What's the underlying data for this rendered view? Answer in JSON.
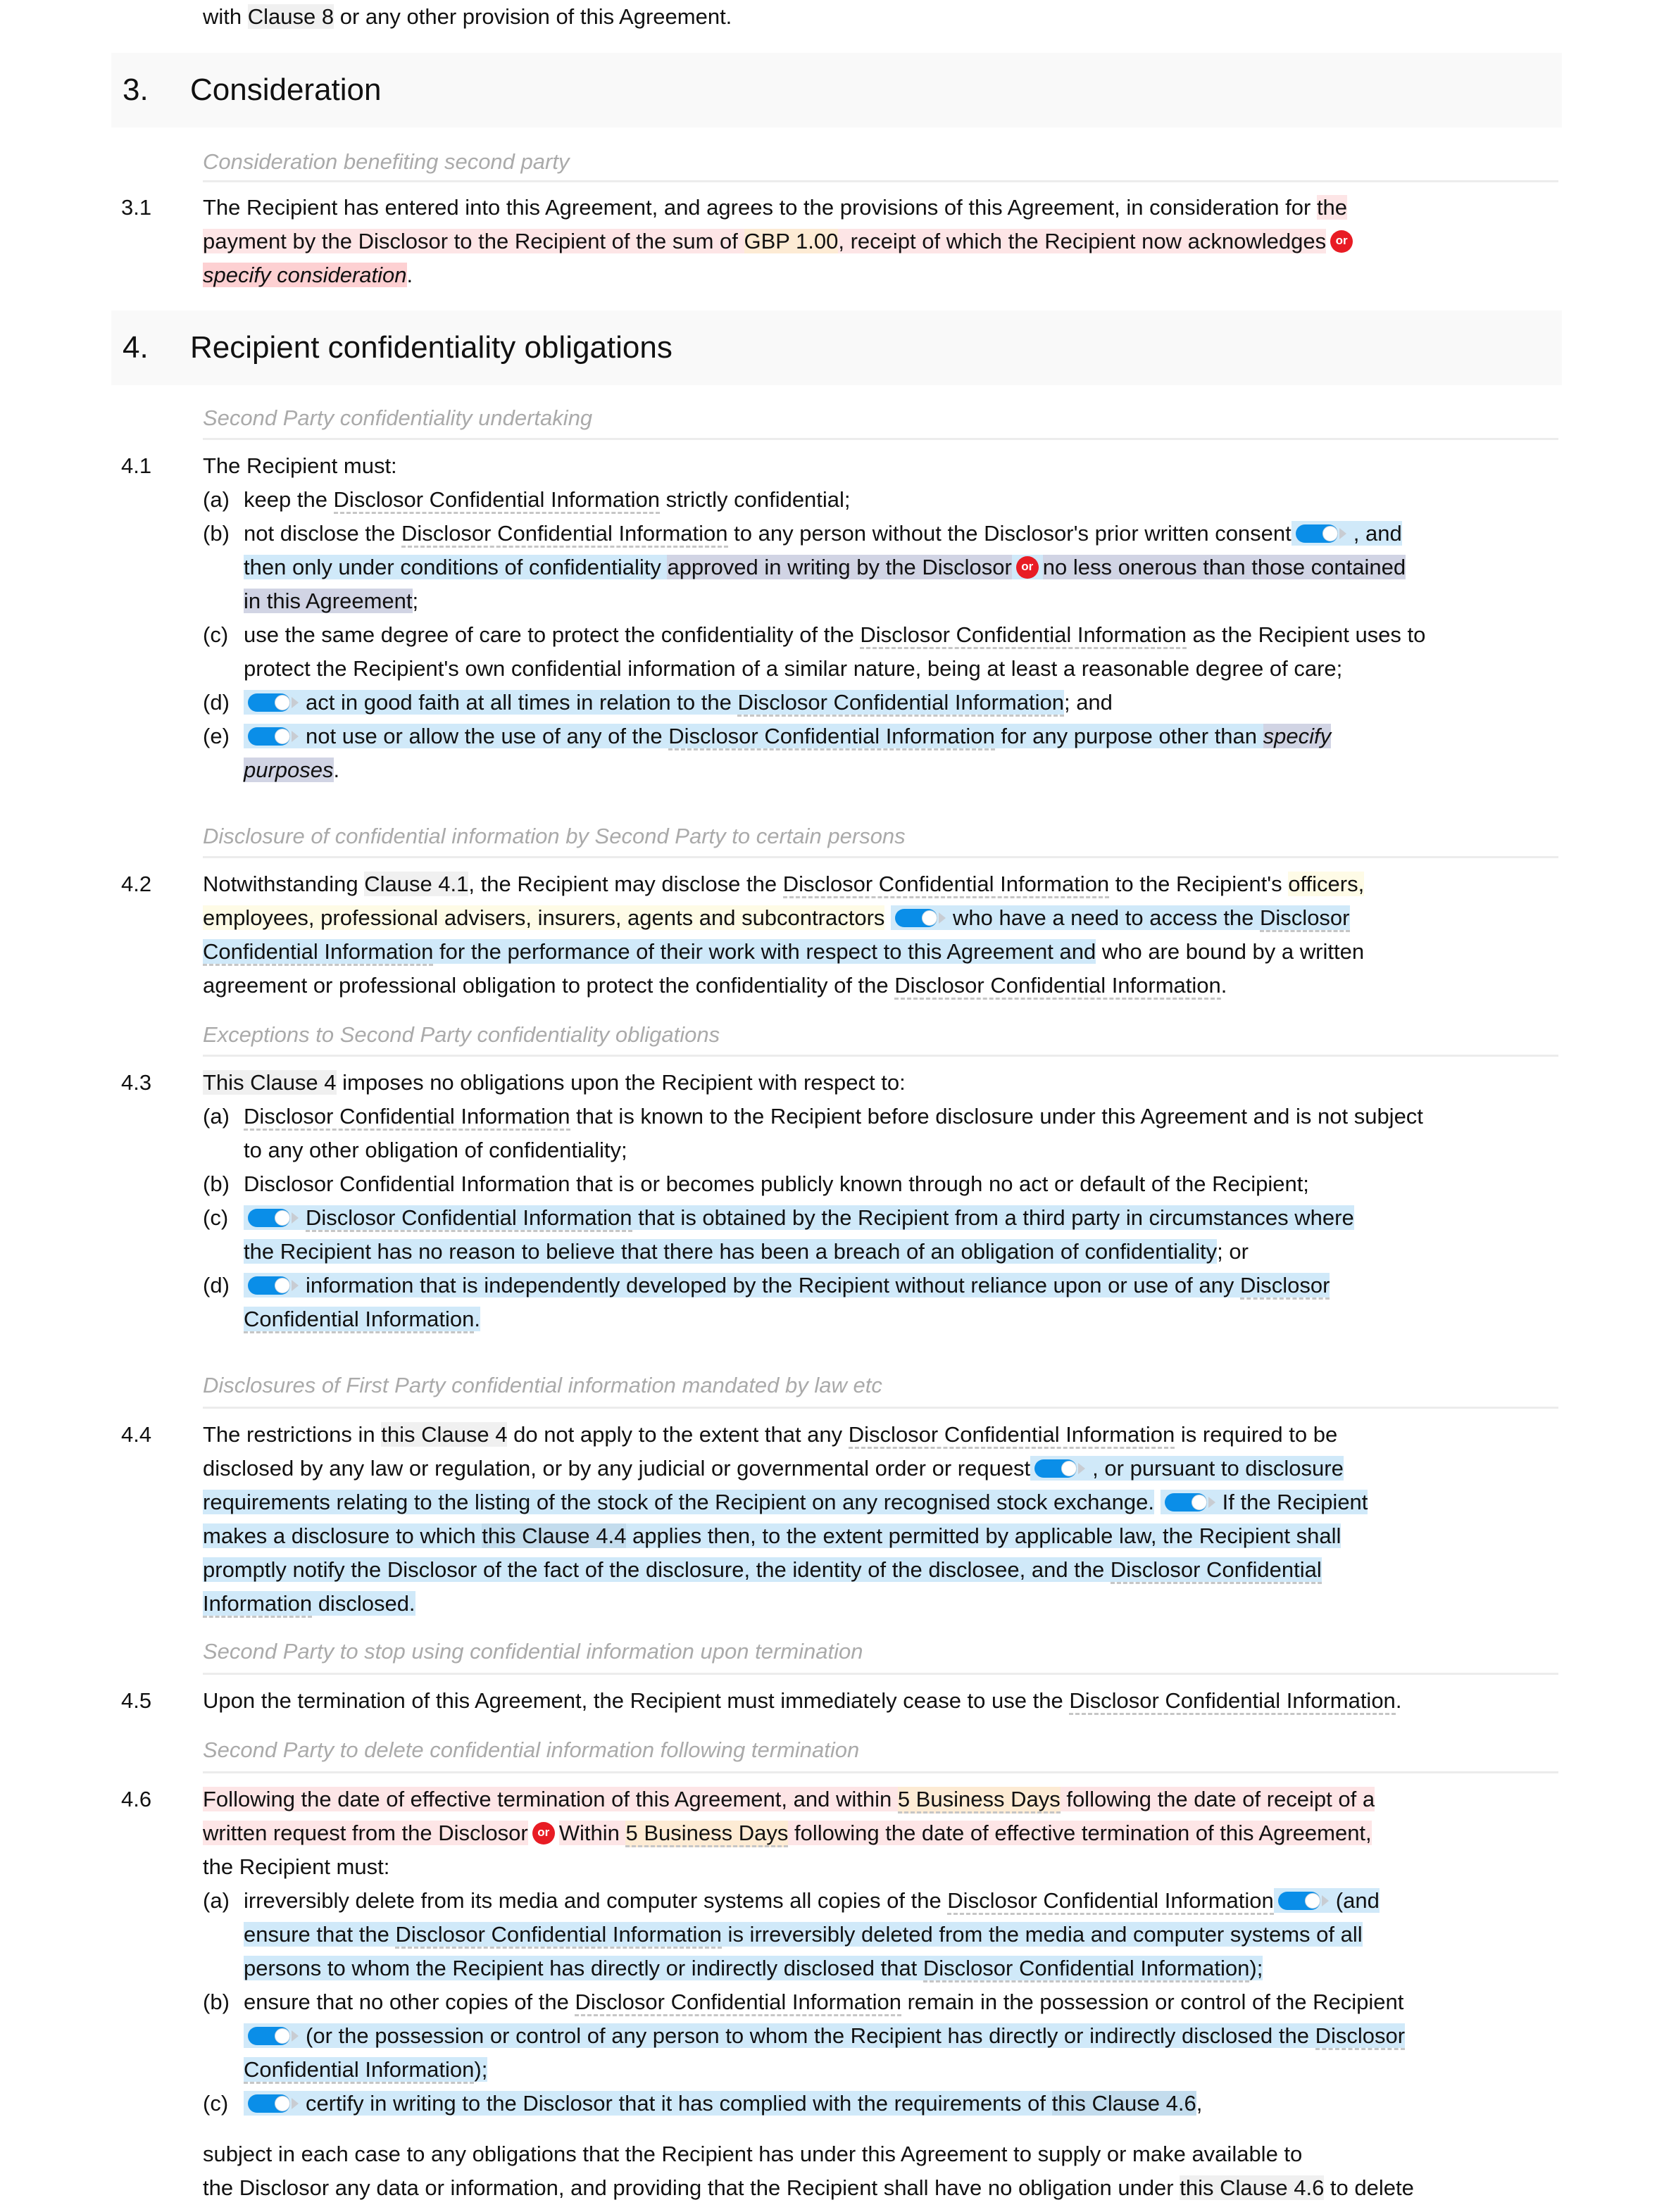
{
  "top": {
    "pre": "with ",
    "clause": "Clause 8",
    "post": " or any other provision of this Agreement."
  },
  "sections": [
    {
      "number": "3.",
      "title": "Consideration"
    },
    {
      "number": "4.",
      "title": "Recipient confidentiality obligations"
    }
  ],
  "s31": {
    "subheading": "Consideration benefiting second party",
    "number": "3.1",
    "l1a": "The Recipient has entered into this Agreement, and agrees to the provisions of this Agreement, in consideration for ",
    "l1b": "the",
    "l2a": "payment by the Disclosor to the Recipient of the sum of ",
    "l2b": "GBP 1.00",
    "l2c": ", receipt of which the Recipient now acknowledges",
    "or": "or",
    "l3a": "specify consideration",
    "l3b": "."
  },
  "s41": {
    "subheading": "Second Party confidentiality undertaking",
    "number": "4.1",
    "intro": "The Recipient must:",
    "a_label": "(a)",
    "a1": "keep the ",
    "a_def": "Disclosor Confidential Information",
    "a2": " strictly confidential;",
    "b_label": "(b)",
    "b1": "not disclose the ",
    "b_def": "Disclosor Confidential Information",
    "b2": " to any person without the Disclosor's prior written consent",
    "b3": ", and",
    "b4": "then only under conditions of confidentiality ",
    "b5": "approved in writing by the Disclosor",
    "b6": "no less onerous than those contained",
    "b7": "in this Agreement",
    "b8": ";",
    "c_label": "(c)",
    "c1": "use the same degree of care to protect the confidentiality of the ",
    "c_def": "Disclosor Confidential Information",
    "c2": " as the Recipient uses to",
    "c3": "protect the Recipient's own confidential information of a similar nature, being at least a reasonable degree of care;",
    "d_label": "(d)",
    "d1": "act in good faith at all times in relation to the ",
    "d_def": "Disclosor Confidential Information",
    "d2": "; and",
    "e_label": "(e)",
    "e1": "not use or allow the use of any of the ",
    "e_def": "Disclosor Confidential Information",
    "e2": " for any purpose other than ",
    "e3": "specify",
    "e4": "purposes",
    "e5": "."
  },
  "s42": {
    "subheading": "Disclosure of confidential information by Second Party to certain persons",
    "number": "4.2",
    "l1a": "Notwithstanding ",
    "l1b": "Clause 4.1",
    "l1c": ", the Recipient may disclose the ",
    "l1d": "Disclosor Confidential Information",
    "l1e": " to the Recipient's ",
    "l1f": "officers,",
    "l2a": "employees, professional advisers, insurers, agents and subcontractors",
    "l2b": "who have a need to access the ",
    "l2c": "Disclosor",
    "l3a": "Confidential Information",
    "l3b": " for the performance of their work with respect to this Agreement and",
    "l3c": " who are bound by a written",
    "l4a": "agreement or professional obligation to protect the confidentiality of the ",
    "l4b": "Disclosor Confidential Information",
    "l4c": "."
  },
  "s43": {
    "subheading": "Exceptions to Second Party confidentiality obligations",
    "number": "4.3",
    "intro_a": "This Clause 4",
    "intro_b": " imposes no obligations upon the Recipient with respect to:",
    "a_label": "(a)",
    "a_def": "Disclosor Confidential Information",
    "a1": " that is known to the Recipient before disclosure under this Agreement and is not subject",
    "a2": "to any other obligation of confidentiality;",
    "b_label": "(b)",
    "b1": "Disclosor Confidential Information that is or becomes publicly known through no act or default of the Recipient;",
    "c_label": "(c)",
    "c_def": "Disclosor Confidential Information",
    "c1": " that is obtained by the Recipient from a third party in circumstances where",
    "c2": "the Recipient has no reason to believe that there has been a breach of an obligation of confidentiality",
    "c3": "; or",
    "d_label": "(d)",
    "d1": "information that is independently developed by the Recipient without reliance upon or use of any ",
    "d_def": "Disclosor",
    "d2": "Confidential Information",
    "d3": "."
  },
  "s44": {
    "subheading": "Disclosures of First Party confidential information mandated by law etc",
    "number": "4.4",
    "l1a": "The restrictions in ",
    "l1b": "this Clause 4",
    "l1c": " do not apply to the extent that any ",
    "l1d": "Disclosor Confidential Information",
    "l1e": " is required to be",
    "l2a": "disclosed by any law or regulation, or by any judicial or governmental order or request",
    "l2b": ", or pursuant to disclosure",
    "l3a": "requirements relating to the listing of the stock of the Recipient on any recognised stock exchange.",
    "l3b": "If the Recipient",
    "l4a": "makes a disclosure to which ",
    "l4b": "this Clause 4.4",
    "l4c": " applies then, to the extent permitted by applicable law, the Recipient shall",
    "l5a": "promptly notify the Disclosor of the fact of the disclosure, the identity of the disclosee, and the ",
    "l5b": "Disclosor Confidential",
    "l6a": "Information",
    "l6b": " disclosed."
  },
  "s45": {
    "subheading": "Second Party to stop using confidential information upon termination",
    "number": "4.5",
    "l1a": "Upon the termination of this Agreement, the Recipient must immediately cease to use the ",
    "l1b": "Disclosor Confidential Information",
    "l1c": "."
  },
  "s46": {
    "subheading": "Second Party to delete confidential information following termination",
    "number": "4.6",
    "l1a": "Following the date of effective termination of this Agreement, and within ",
    "l1b": "5 Business Days",
    "l1c": " following the date of receipt of a",
    "l2a": "written request from the Disclosor",
    "or": "or",
    "l2b": "Within ",
    "l2c": "5 Business Days",
    "l2d": " following the date of effective termination of this Agreement,",
    "l3": "the Recipient must:",
    "a_label": "(a)",
    "a1": "irreversibly delete from its media and computer systems all copies of the ",
    "a_def": "Disclosor Confidential Information",
    "a2": "(and",
    "a3": "ensure that the ",
    "a3_def": "Disclosor Confidential Information",
    "a4": " is irreversibly deleted from the media and computer systems of all",
    "a5": "persons to whom the Recipient has directly or indirectly disclosed that ",
    "a5_def": "Disclosor Confidential Information",
    "a6": ");",
    "b_label": "(b)",
    "b1": "ensure that no other copies of the ",
    "b_def": "Disclosor Confidential Information",
    "b2": " remain in the possession or control of the Recipient",
    "b3": "(or the possession or control of any person to whom the Recipient has directly or indirectly disclosed the ",
    "b3_def": "Disclosor",
    "b4": "Confidential Information",
    "b5": ");",
    "c_label": "(c)",
    "c1": "certify in writing to the Disclosor that it has complied with the requirements of ",
    "c2": "this Clause 4.6",
    "c3": ",",
    "tail1": "subject in each case to any obligations that the Recipient has under this Agreement to supply or make available to",
    "tail2a": "the Disclosor any data or information, and providing that the Recipient shall have no obligation under ",
    "tail2b": "this Clause 4.6",
    "tail2c": " to delete"
  },
  "colors": {
    "toggle": "#0a8ee8",
    "or_badge": "#e81c24",
    "optional_highlight": "#d0e9f9",
    "alternative_highlight": "#fde5e6",
    "variable_highlight": "#fdebd4"
  }
}
